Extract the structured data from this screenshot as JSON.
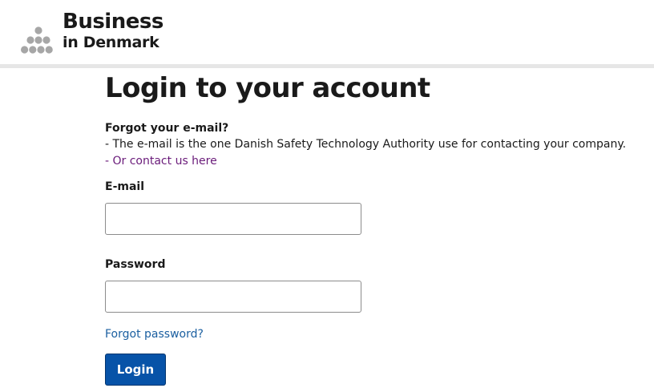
{
  "header": {
    "logo_line1": "Business",
    "logo_line2": "in Denmark",
    "logo_icon": "dots-logo-icon"
  },
  "main": {
    "title": "Login to your account",
    "forgot_email_heading": "Forgot your e-mail?",
    "info_text": "- The e-mail is the one Danish Safety Technology Authority use for contacting your company.",
    "contact_link": "- Or contact us here",
    "email_label": "E-mail",
    "email_value": "",
    "password_label": "Password",
    "password_value": "",
    "forgot_password_link": "Forgot password?",
    "login_button": "Login"
  },
  "colors": {
    "link": "#1b5fa0",
    "visited_link": "#6a1b7a",
    "button": "#0753a8",
    "logo_dots": "#a6a6a6",
    "header_rule": "#e6e6e6"
  }
}
